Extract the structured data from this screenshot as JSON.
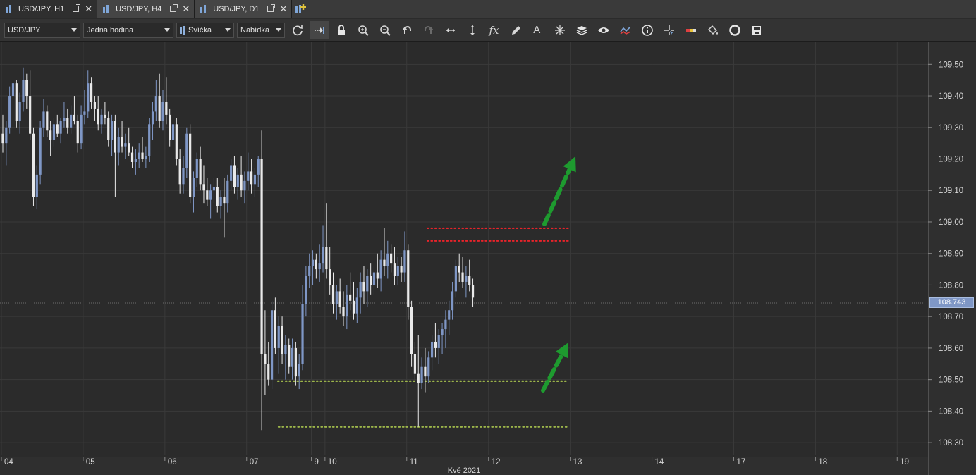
{
  "tabs": [
    {
      "label": "USD/JPY, H1",
      "active": true
    },
    {
      "label": "USD/JPY, H4",
      "active": false
    },
    {
      "label": "USD/JPY, D1",
      "active": false
    }
  ],
  "toolbar": {
    "instrument": "USD/JPY",
    "period": "Jedna hodina",
    "chart_type": "Svíčka",
    "price_side": "Nabídka",
    "tools": [
      "refresh-icon",
      "shift-chart-icon",
      "lock-icon",
      "zoom-in-icon",
      "zoom-out-icon",
      "undo-icon",
      "redo-icon",
      "horizontal-resize-icon",
      "vertical-resize-icon",
      "indicator-fx-icon",
      "pencil-icon",
      "text-tool-icon",
      "crosshair-star-icon",
      "layers-icon",
      "eye-icon",
      "compare-chart-icon",
      "info-icon",
      "cursor-cross-icon",
      "color-bar-icon",
      "paint-bucket-icon",
      "theme-icon",
      "save-icon"
    ]
  },
  "chart_data": {
    "type": "candlestick",
    "instrument": "USD/JPY",
    "y_ticks": [
      "109.50",
      "109.40",
      "109.30",
      "109.20",
      "109.10",
      "109.00",
      "108.90",
      "108.80",
      "108.70",
      "108.60",
      "108.50",
      "108.40",
      "108.30"
    ],
    "ylim": [
      108.26,
      109.57
    ],
    "current_price": "108.743",
    "x_ticks": [
      {
        "label": "04",
        "index": 0
      },
      {
        "label": "05",
        "index": 24
      },
      {
        "label": "06",
        "index": 48
      },
      {
        "label": "07",
        "index": 72
      },
      {
        "label": "9",
        "index": 91
      },
      {
        "label": "10",
        "index": 95
      },
      {
        "label": "11",
        "index": 119
      },
      {
        "label": "12",
        "index": 143
      },
      {
        "label": "13",
        "index": 167
      },
      {
        "label": "14",
        "index": 191
      },
      {
        "label": "17",
        "index": 215
      },
      {
        "label": "18",
        "index": 239
      },
      {
        "label": "19",
        "index": 263
      }
    ],
    "x_caption": "Kvě 2021",
    "candles": [
      [
        109.28,
        109.34,
        109.22,
        109.25
      ],
      [
        109.25,
        109.32,
        109.18,
        109.3
      ],
      [
        109.3,
        109.43,
        109.28,
        109.4
      ],
      [
        109.4,
        109.49,
        109.36,
        109.44
      ],
      [
        109.44,
        109.45,
        109.3,
        109.32
      ],
      [
        109.32,
        109.41,
        109.28,
        109.38
      ],
      [
        109.38,
        109.49,
        109.35,
        109.45
      ],
      [
        109.45,
        109.47,
        109.36,
        109.4
      ],
      [
        109.4,
        109.48,
        109.26,
        109.28
      ],
      [
        109.28,
        109.3,
        109.05,
        109.08
      ],
      [
        109.08,
        109.18,
        109.04,
        109.15
      ],
      [
        109.15,
        109.32,
        109.12,
        109.3
      ],
      [
        109.3,
        109.39,
        109.27,
        109.35
      ],
      [
        109.35,
        109.37,
        109.27,
        109.29
      ],
      [
        109.29,
        109.32,
        109.21,
        109.26
      ],
      [
        109.26,
        109.33,
        109.24,
        109.31
      ],
      [
        109.31,
        109.34,
        109.27,
        109.28
      ],
      [
        109.28,
        109.33,
        109.25,
        109.32
      ],
      [
        109.32,
        109.38,
        109.3,
        109.33
      ],
      [
        109.33,
        109.36,
        109.28,
        109.3
      ],
      [
        109.3,
        109.37,
        109.28,
        109.34
      ],
      [
        109.34,
        109.4,
        109.31,
        109.32
      ],
      [
        109.32,
        109.34,
        109.22,
        109.25
      ],
      [
        109.25,
        109.37,
        109.23,
        109.34
      ],
      [
        109.34,
        109.42,
        109.31,
        109.35
      ],
      [
        109.35,
        109.48,
        109.33,
        109.44
      ],
      [
        109.44,
        109.46,
        109.36,
        109.38
      ],
      [
        109.38,
        109.4,
        109.32,
        109.36
      ],
      [
        109.36,
        109.4,
        109.29,
        109.31
      ],
      [
        109.31,
        109.36,
        109.28,
        109.34
      ],
      [
        109.34,
        109.38,
        109.31,
        109.33
      ],
      [
        109.33,
        109.35,
        109.24,
        109.26
      ],
      [
        109.26,
        109.34,
        109.21,
        109.32
      ],
      [
        109.32,
        109.34,
        109.08,
        109.22
      ],
      [
        109.22,
        109.3,
        109.18,
        109.27
      ],
      [
        109.27,
        109.32,
        109.22,
        109.24
      ],
      [
        109.24,
        109.28,
        109.2,
        109.25
      ],
      [
        109.25,
        109.3,
        109.21,
        109.22
      ],
      [
        109.22,
        109.24,
        109.17,
        109.19
      ],
      [
        109.19,
        109.23,
        109.15,
        109.2
      ],
      [
        109.2,
        109.25,
        109.17,
        109.22
      ],
      [
        109.22,
        109.27,
        109.19,
        109.2
      ],
      [
        109.2,
        109.24,
        109.17,
        109.21
      ],
      [
        109.21,
        109.33,
        109.19,
        109.31
      ],
      [
        109.31,
        109.38,
        109.26,
        109.35
      ],
      [
        109.35,
        109.45,
        109.32,
        109.4
      ],
      [
        109.4,
        109.47,
        109.3,
        109.32
      ],
      [
        109.32,
        109.42,
        109.29,
        109.38
      ],
      [
        109.38,
        109.46,
        109.31,
        109.34
      ],
      [
        109.34,
        109.36,
        109.24,
        109.26
      ],
      [
        109.26,
        109.35,
        109.22,
        109.31
      ],
      [
        109.31,
        109.33,
        109.18,
        109.2
      ],
      [
        109.2,
        109.23,
        109.09,
        109.12
      ],
      [
        109.12,
        109.21,
        109.09,
        109.17
      ],
      [
        109.17,
        109.3,
        109.14,
        109.28
      ],
      [
        109.28,
        109.31,
        109.06,
        109.08
      ],
      [
        109.08,
        109.16,
        109.03,
        109.14
      ],
      [
        109.14,
        109.22,
        109.11,
        109.2
      ],
      [
        109.2,
        109.24,
        109.1,
        109.12
      ],
      [
        109.12,
        109.18,
        109.06,
        109.1
      ],
      [
        109.1,
        109.14,
        109.05,
        109.07
      ],
      [
        109.07,
        109.12,
        109.01,
        109.1
      ],
      [
        109.1,
        109.14,
        109.06,
        109.11
      ],
      [
        109.11,
        109.14,
        109.03,
        109.05
      ],
      [
        109.05,
        109.1,
        109.01,
        109.08
      ],
      [
        109.08,
        109.14,
        108.95,
        109.06
      ],
      [
        109.06,
        109.15,
        109.03,
        109.13
      ],
      [
        109.13,
        109.2,
        109.1,
        109.18
      ],
      [
        109.18,
        109.21,
        109.09,
        109.11
      ],
      [
        109.11,
        109.17,
        109.07,
        109.15
      ],
      [
        109.15,
        109.21,
        109.08,
        109.1
      ],
      [
        109.1,
        109.16,
        109.06,
        109.13
      ],
      [
        109.13,
        109.22,
        109.1,
        109.16
      ],
      [
        109.16,
        109.2,
        109.09,
        109.12
      ],
      [
        109.12,
        109.17,
        109.08,
        109.15
      ],
      [
        109.15,
        109.21,
        109.11,
        109.2
      ],
      [
        109.2,
        109.29,
        108.34,
        108.58
      ],
      [
        108.58,
        108.72,
        108.45,
        108.55
      ],
      [
        108.55,
        108.62,
        108.48,
        108.5
      ],
      [
        108.5,
        108.75,
        108.47,
        108.72
      ],
      [
        108.72,
        108.76,
        108.58,
        108.6
      ],
      [
        108.6,
        108.7,
        108.52,
        108.67
      ],
      [
        108.67,
        108.7,
        108.55,
        108.58
      ],
      [
        108.58,
        108.64,
        108.5,
        108.61
      ],
      [
        108.61,
        108.63,
        108.52,
        108.54
      ],
      [
        108.54,
        108.63,
        108.5,
        108.6
      ],
      [
        108.6,
        108.62,
        108.48,
        108.51
      ],
      [
        108.51,
        108.58,
        108.47,
        108.55
      ],
      [
        108.55,
        108.8,
        108.53,
        108.74
      ],
      [
        108.74,
        108.86,
        108.7,
        108.83
      ],
      [
        108.83,
        108.9,
        108.79,
        108.86
      ],
      [
        108.86,
        108.91,
        108.8,
        108.88
      ],
      [
        108.88,
        108.9,
        108.82,
        108.85
      ],
      [
        108.85,
        108.93,
        108.81,
        108.87
      ],
      [
        108.87,
        108.99,
        108.84,
        108.92
      ],
      [
        108.92,
        109.06,
        108.82,
        108.85
      ],
      [
        108.85,
        108.92,
        108.77,
        108.8
      ],
      [
        108.8,
        108.84,
        108.71,
        108.74
      ],
      [
        108.74,
        108.8,
        108.69,
        108.78
      ],
      [
        108.78,
        108.82,
        108.71,
        108.73
      ],
      [
        108.73,
        108.78,
        108.67,
        108.7
      ],
      [
        108.7,
        108.8,
        108.66,
        108.77
      ],
      [
        108.77,
        108.84,
        108.72,
        108.75
      ],
      [
        108.75,
        108.81,
        108.69,
        108.71
      ],
      [
        108.71,
        108.79,
        108.68,
        108.76
      ],
      [
        108.76,
        108.84,
        108.71,
        108.81
      ],
      [
        108.81,
        108.86,
        108.74,
        108.78
      ],
      [
        108.78,
        108.85,
        108.73,
        108.83
      ],
      [
        108.83,
        108.87,
        108.77,
        108.8
      ],
      [
        108.8,
        108.86,
        108.77,
        108.84
      ],
      [
        108.84,
        108.9,
        108.79,
        108.82
      ],
      [
        108.82,
        108.91,
        108.78,
        108.88
      ],
      [
        108.88,
        108.98,
        108.83,
        108.86
      ],
      [
        108.86,
        108.94,
        108.82,
        108.9
      ],
      [
        108.9,
        108.93,
        108.84,
        108.87
      ],
      [
        108.87,
        108.92,
        108.8,
        108.83
      ],
      [
        108.83,
        108.89,
        108.8,
        108.86
      ],
      [
        108.86,
        108.89,
        108.81,
        108.84
      ],
      [
        108.84,
        108.97,
        108.81,
        108.91
      ],
      [
        108.91,
        108.93,
        108.69,
        108.73
      ],
      [
        108.73,
        108.75,
        108.54,
        108.58
      ],
      [
        108.58,
        108.62,
        108.5,
        108.52
      ],
      [
        108.52,
        108.64,
        108.35,
        108.49
      ],
      [
        108.49,
        108.57,
        108.47,
        108.54
      ],
      [
        108.54,
        108.6,
        108.46,
        108.51
      ],
      [
        108.51,
        108.59,
        108.49,
        108.57
      ],
      [
        108.57,
        108.64,
        108.53,
        108.62
      ],
      [
        108.62,
        108.68,
        108.57,
        108.6
      ],
      [
        108.6,
        108.66,
        108.55,
        108.64
      ],
      [
        108.64,
        108.68,
        108.58,
        108.66
      ],
      [
        108.66,
        108.72,
        108.6,
        108.69
      ],
      [
        108.69,
        108.75,
        108.64,
        108.72
      ],
      [
        108.72,
        108.81,
        108.69,
        108.78
      ],
      [
        108.78,
        108.88,
        108.76,
        108.86
      ],
      [
        108.86,
        108.9,
        108.81,
        108.84
      ],
      [
        108.84,
        108.89,
        108.79,
        108.81
      ],
      [
        108.81,
        108.86,
        108.76,
        108.83
      ],
      [
        108.83,
        108.88,
        108.78,
        108.8
      ],
      [
        108.8,
        108.82,
        108.73,
        108.76
      ]
    ],
    "resistance_levels": [
      108.98,
      108.94
    ],
    "support_levels": [
      108.495,
      108.35
    ],
    "colors": {
      "bullish": "#7f97c6",
      "bearish": "#e9e9e9",
      "resistance": "#e8232a",
      "support": "#9cb54a",
      "arrow": "#1e9a2f",
      "grid": "#3a3a3a",
      "background": "#2b2b2b"
    }
  }
}
